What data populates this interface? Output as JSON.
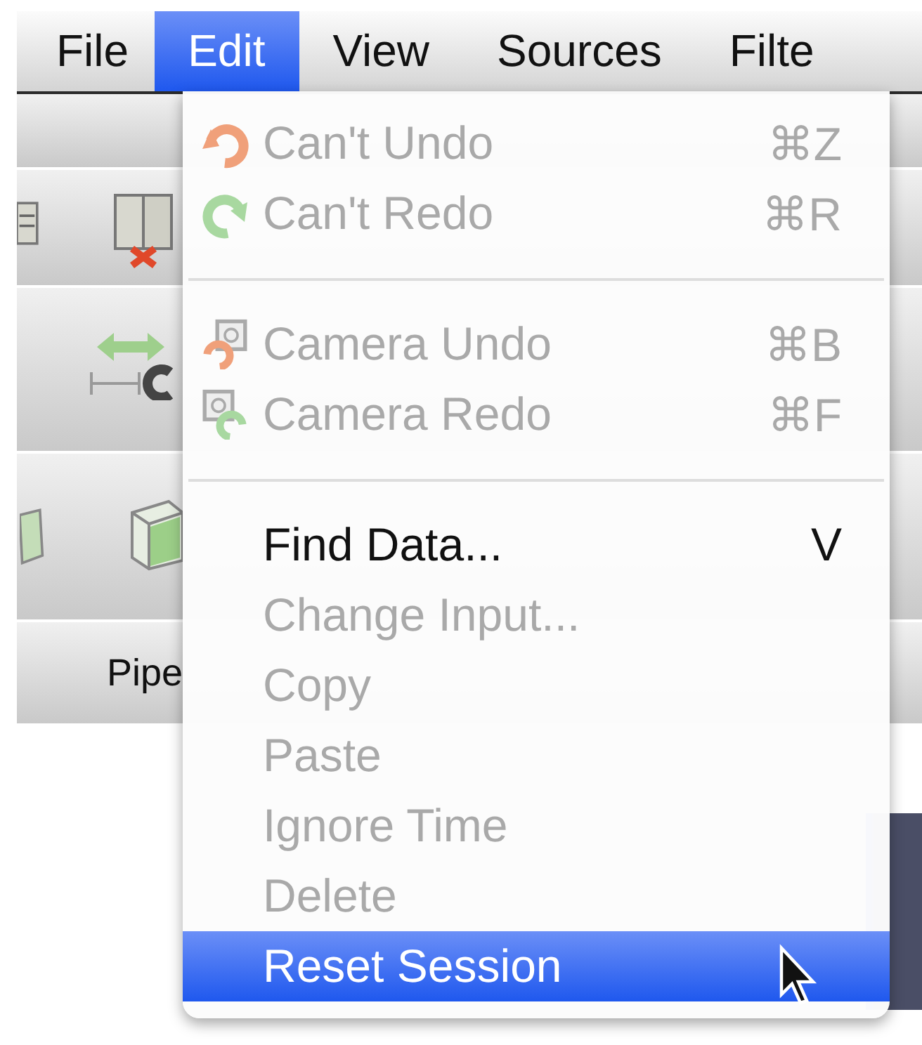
{
  "menubar": [
    {
      "label": "File",
      "selected": false
    },
    {
      "label": "Edit",
      "selected": true
    },
    {
      "label": "View",
      "selected": false
    },
    {
      "label": "Sources",
      "selected": false
    },
    {
      "label": "Filte",
      "selected": false
    }
  ],
  "background": {
    "tab_label": "Pipe"
  },
  "menu": {
    "items": [
      {
        "kind": "undo",
        "label": "Can't Undo",
        "shortcut": "⌘Z",
        "disabled": true,
        "selected": false
      },
      {
        "kind": "redo",
        "label": "Can't Redo",
        "shortcut": "⌘R",
        "disabled": true,
        "selected": false
      },
      {
        "kind": "separator"
      },
      {
        "kind": "camera-undo",
        "label": "Camera Undo",
        "shortcut": "⌘B",
        "disabled": true,
        "selected": false
      },
      {
        "kind": "camera-redo",
        "label": "Camera Redo",
        "shortcut": "⌘F",
        "disabled": true,
        "selected": false
      },
      {
        "kind": "separator"
      },
      {
        "kind": "plain",
        "label": "Find Data...",
        "shortcut": "V",
        "disabled": false,
        "selected": false
      },
      {
        "kind": "plain",
        "label": "Change Input...",
        "disabled": true,
        "selected": false
      },
      {
        "kind": "plain",
        "label": "Copy",
        "disabled": true,
        "selected": false
      },
      {
        "kind": "plain",
        "label": "Paste",
        "disabled": true,
        "selected": false
      },
      {
        "kind": "plain",
        "label": "Ignore Time",
        "disabled": true,
        "selected": false
      },
      {
        "kind": "plain",
        "label": "Delete",
        "disabled": true,
        "selected": false
      },
      {
        "kind": "plain",
        "label": "Reset Session",
        "disabled": false,
        "selected": true
      }
    ]
  }
}
